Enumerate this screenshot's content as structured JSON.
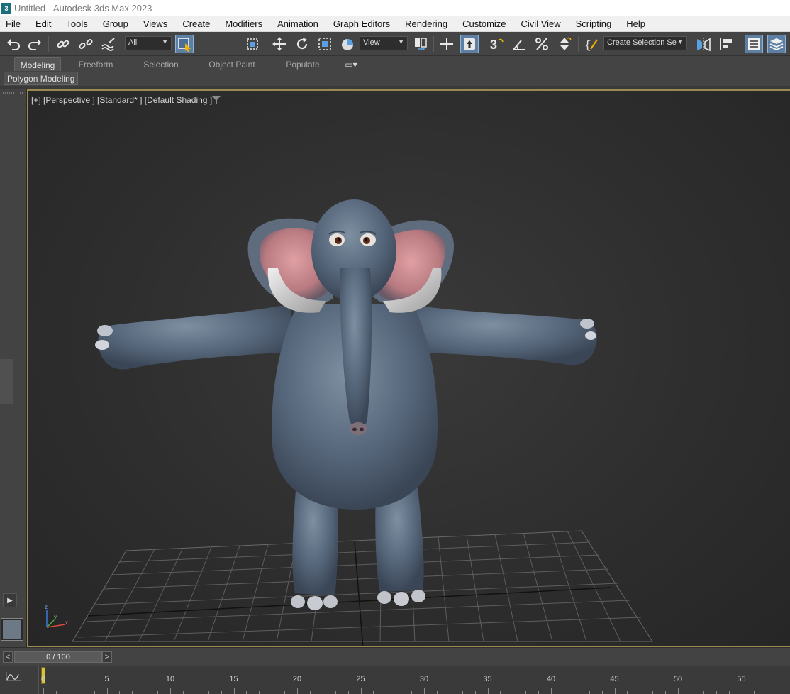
{
  "window": {
    "app_icon_label": "3",
    "title": "Untitled - Autodesk 3ds Max 2023"
  },
  "menu": [
    "File",
    "Edit",
    "Tools",
    "Group",
    "Views",
    "Create",
    "Modifiers",
    "Animation",
    "Graph Editors",
    "Rendering",
    "Customize",
    "Civil View",
    "Scripting",
    "Help"
  ],
  "toolbar": {
    "selection_filter": "All",
    "reference_coord": "View",
    "named_selection_set": "Create Selection Se",
    "angle_snap_label": "3",
    "icons": [
      "undo-icon",
      "redo-icon",
      "link-icon",
      "unlink-icon",
      "bind-spacewarp-icon",
      "select-object-icon",
      "rect-region-icon",
      "move-icon",
      "rotate-icon",
      "scale-icon",
      "place-icon",
      "mirror-icon",
      "pivot-icon",
      "manipulate-icon",
      "snap-icon",
      "angle-snap-icon",
      "percent-snap-icon",
      "spinner-snap-icon",
      "edit-named-sets-icon",
      "mirror-tool-icon",
      "align-icon",
      "scene-explorer-icon",
      "layer-explorer-icon"
    ]
  },
  "ribbon": {
    "tabs": [
      {
        "label": "Modeling",
        "selected": true
      },
      {
        "label": "Freeform",
        "selected": false
      },
      {
        "label": "Selection",
        "selected": false
      },
      {
        "label": "Object Paint",
        "selected": false
      },
      {
        "label": "Populate",
        "selected": false
      }
    ],
    "panel_button": "Polygon Modeling"
  },
  "viewport": {
    "label": "[+] [Perspective ] [Standard* ] [Default Shading ]",
    "axis_labels": {
      "x": "x",
      "y": "y",
      "z": "z"
    },
    "object": "cartoon elephant model",
    "accent_color": "#9a8a50"
  },
  "timeline": {
    "prev_label": "<",
    "next_label": ">",
    "frame_display": "0 / 100",
    "current_frame": 0,
    "total_frames": 100,
    "ticks": [
      "0",
      "5",
      "10",
      "15",
      "20",
      "25",
      "30",
      "35",
      "40",
      "45",
      "50",
      "55"
    ]
  }
}
